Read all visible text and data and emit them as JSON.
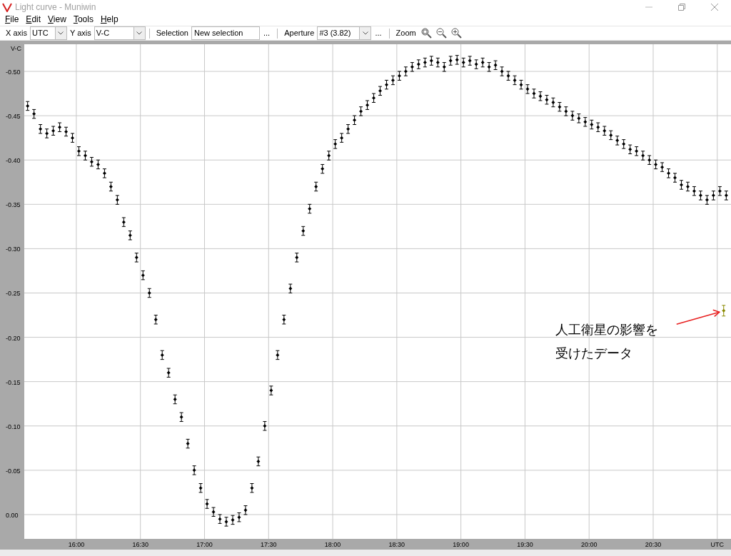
{
  "window": {
    "title": "Light curve - Muniwin"
  },
  "menu": [
    "File",
    "Edit",
    "View",
    "Tools",
    "Help"
  ],
  "toolbar": {
    "x_axis": {
      "label": "X axis",
      "value": "UTC"
    },
    "y_axis": {
      "label": "Y axis",
      "value": "V-C"
    },
    "selection": {
      "label": "Selection",
      "value": "New selection",
      "more": "..."
    },
    "aperture": {
      "label": "Aperture",
      "value": "#3 (3.82)",
      "more": "..."
    },
    "zoom": {
      "label": "Zoom"
    }
  },
  "chart": {
    "chart_data": {
      "type": "scatter",
      "ylabel": "V-C",
      "xlim": [
        15.594,
        21.107
      ],
      "ylim": [
        0.0274,
        -0.5306
      ],
      "xticks": [
        {
          "value": 16,
          "label": "16:00"
        },
        {
          "value": 16.5,
          "label": "16:30"
        },
        {
          "value": 17,
          "label": "17:00"
        },
        {
          "value": 17.5,
          "label": "17:30"
        },
        {
          "value": 18,
          "label": "18:00"
        },
        {
          "value": 18.5,
          "label": "18:30"
        },
        {
          "value": 19,
          "label": "19:00"
        },
        {
          "value": 19.5,
          "label": "19:30"
        },
        {
          "value": 20,
          "label": "20:00"
        },
        {
          "value": 20.5,
          "label": "20:30"
        },
        {
          "value": 21,
          "label": "UTC"
        }
      ],
      "yticks": [
        {
          "value": -0.5,
          "label": "-0.50"
        },
        {
          "value": -0.45,
          "label": "-0.45"
        },
        {
          "value": -0.4,
          "label": "-0.40"
        },
        {
          "value": -0.35,
          "label": "-0.35"
        },
        {
          "value": -0.3,
          "label": "-0.30"
        },
        {
          "value": -0.25,
          "label": "-0.25"
        },
        {
          "value": -0.2,
          "label": "-0.20"
        },
        {
          "value": -0.15,
          "label": "-0.15"
        },
        {
          "value": -0.1,
          "label": "-0.10"
        },
        {
          "value": -0.05,
          "label": "-0.05"
        },
        {
          "value": 0,
          "label": "0.00"
        }
      ],
      "grid": true,
      "x": [
        15.62,
        15.67,
        15.72,
        15.77,
        15.82,
        15.87,
        15.92,
        15.97,
        16.02,
        16.07,
        16.12,
        16.17,
        16.22,
        16.27,
        16.32,
        16.37,
        16.42,
        16.47,
        16.52,
        16.57,
        16.62,
        16.67,
        16.72,
        16.77,
        16.82,
        16.87,
        16.92,
        16.97,
        17.02,
        17.07,
        17.12,
        17.17,
        17.22,
        17.27,
        17.32,
        17.37,
        17.42,
        17.47,
        17.52,
        17.57,
        17.62,
        17.67,
        17.72,
        17.77,
        17.82,
        17.87,
        17.92,
        17.97,
        18.02,
        18.07,
        18.12,
        18.17,
        18.22,
        18.27,
        18.32,
        18.37,
        18.42,
        18.47,
        18.52,
        18.57,
        18.62,
        18.67,
        18.72,
        18.77,
        18.82,
        18.87,
        18.92,
        18.97,
        19.02,
        19.07,
        19.12,
        19.17,
        19.22,
        19.27,
        19.32,
        19.37,
        19.42,
        19.47,
        19.52,
        19.57,
        19.62,
        19.67,
        19.72,
        19.77,
        19.82,
        19.87,
        19.92,
        19.97,
        20.02,
        20.07,
        20.12,
        20.17,
        20.22,
        20.27,
        20.32,
        20.37,
        20.42,
        20.47,
        20.52,
        20.57,
        20.62,
        20.67,
        20.72,
        20.77,
        20.82,
        20.87,
        20.92,
        20.97,
        21.02,
        21.05,
        21.07
      ],
      "series": [
        {
          "color": "#000000",
          "values": [
            -0.461,
            -0.452,
            -0.435,
            -0.43,
            -0.433,
            -0.437,
            -0.432,
            -0.425,
            -0.41,
            -0.405,
            -0.398,
            -0.395,
            -0.385,
            -0.37,
            -0.355,
            -0.33,
            -0.315,
            -0.29,
            -0.27,
            -0.25,
            -0.22,
            -0.18,
            -0.16,
            -0.13,
            -0.11,
            -0.08,
            -0.05,
            -0.03,
            -0.012,
            -0.003,
            0.005,
            0.008,
            0.006,
            0.003,
            -0.005,
            -0.03,
            -0.06,
            -0.1,
            -0.14,
            -0.18,
            -0.22,
            -0.255,
            -0.29,
            -0.32,
            -0.345,
            -0.37,
            -0.39,
            -0.405,
            -0.418,
            -0.425,
            -0.435,
            -0.445,
            -0.455,
            -0.462,
            -0.47,
            -0.478,
            -0.485,
            -0.49,
            -0.495,
            -0.5,
            -0.505,
            -0.508,
            -0.51,
            -0.512,
            -0.51,
            -0.505,
            -0.512,
            -0.513,
            -0.51,
            -0.512,
            -0.508,
            -0.51,
            -0.505,
            -0.507,
            -0.5,
            -0.495,
            -0.49,
            -0.485,
            -0.48,
            -0.475,
            -0.472,
            -0.468,
            -0.465,
            -0.46,
            -0.455,
            -0.45,
            -0.447,
            -0.443,
            -0.44,
            -0.437,
            -0.433,
            -0.428,
            -0.422,
            -0.418,
            -0.412,
            -0.41,
            -0.405,
            -0.4,
            -0.395,
            -0.392,
            -0.385,
            -0.38,
            -0.372,
            -0.37,
            -0.365,
            -0.36,
            -0.355,
            -0.36,
            -0.365,
            null,
            -0.36
          ],
          "errors": [
            0.005,
            0.005,
            0.005,
            0.005,
            0.005,
            0.005,
            0.005,
            0.005,
            0.005,
            0.005,
            0.005,
            0.005,
            0.005,
            0.005,
            0.005,
            0.005,
            0.005,
            0.005,
            0.005,
            0.005,
            0.005,
            0.005,
            0.005,
            0.005,
            0.005,
            0.005,
            0.005,
            0.005,
            0.005,
            0.005,
            0.005,
            0.005,
            0.005,
            0.005,
            0.005,
            0.005,
            0.005,
            0.005,
            0.005,
            0.005,
            0.005,
            0.005,
            0.005,
            0.005,
            0.005,
            0.005,
            0.005,
            0.005,
            0.005,
            0.005,
            0.005,
            0.005,
            0.005,
            0.005,
            0.005,
            0.005,
            0.005,
            0.005,
            0.005,
            0.005,
            0.005,
            0.005,
            0.005,
            0.005,
            0.005,
            0.005,
            0.005,
            0.005,
            0.005,
            0.005,
            0.005,
            0.005,
            0.005,
            0.005,
            0.005,
            0.005,
            0.005,
            0.005,
            0.005,
            0.005,
            0.005,
            0.005,
            0.005,
            0.005,
            0.005,
            0.005,
            0.005,
            0.005,
            0.005,
            0.005,
            0.005,
            0.005,
            0.005,
            0.005,
            0.005,
            0.005,
            0.005,
            0.005,
            0.005,
            0.005,
            0.005,
            0.005,
            0.005,
            0.005,
            0.005,
            0.005,
            0.005,
            0.005,
            0.005,
            null,
            0.005
          ]
        },
        {
          "color": "#8a8a00",
          "values": [
            null,
            null,
            null,
            null,
            null,
            null,
            null,
            null,
            null,
            null,
            null,
            null,
            null,
            null,
            null,
            null,
            null,
            null,
            null,
            null,
            null,
            null,
            null,
            null,
            null,
            null,
            null,
            null,
            null,
            null,
            null,
            null,
            null,
            null,
            null,
            null,
            null,
            null,
            null,
            null,
            null,
            null,
            null,
            null,
            null,
            null,
            null,
            null,
            null,
            null,
            null,
            null,
            null,
            null,
            null,
            null,
            null,
            null,
            null,
            null,
            null,
            null,
            null,
            null,
            null,
            null,
            null,
            null,
            null,
            null,
            null,
            null,
            null,
            null,
            null,
            null,
            null,
            null,
            null,
            null,
            null,
            null,
            null,
            null,
            null,
            null,
            null,
            null,
            null,
            null,
            null,
            null,
            null,
            null,
            null,
            null,
            null,
            null,
            null,
            null,
            null,
            null,
            null,
            null,
            null,
            null,
            null,
            null,
            null,
            -0.23,
            null
          ],
          "errors": [
            null,
            null,
            null,
            null,
            null,
            null,
            null,
            null,
            null,
            null,
            null,
            null,
            null,
            null,
            null,
            null,
            null,
            null,
            null,
            null,
            null,
            null,
            null,
            null,
            null,
            null,
            null,
            null,
            null,
            null,
            null,
            null,
            null,
            null,
            null,
            null,
            null,
            null,
            null,
            null,
            null,
            null,
            null,
            null,
            null,
            null,
            null,
            null,
            null,
            null,
            null,
            null,
            null,
            null,
            null,
            null,
            null,
            null,
            null,
            null,
            null,
            null,
            null,
            null,
            null,
            null,
            null,
            null,
            null,
            null,
            null,
            null,
            null,
            null,
            null,
            null,
            null,
            null,
            null,
            null,
            null,
            null,
            null,
            null,
            null,
            null,
            null,
            null,
            null,
            null,
            null,
            null,
            null,
            null,
            null,
            null,
            null,
            null,
            null,
            null,
            null,
            null,
            null,
            null,
            null,
            null,
            null,
            null,
            null,
            0.006,
            null
          ]
        }
      ],
      "annotations": [
        {
          "text": "人工衛星の影響を受けたデータ"
        }
      ]
    }
  }
}
